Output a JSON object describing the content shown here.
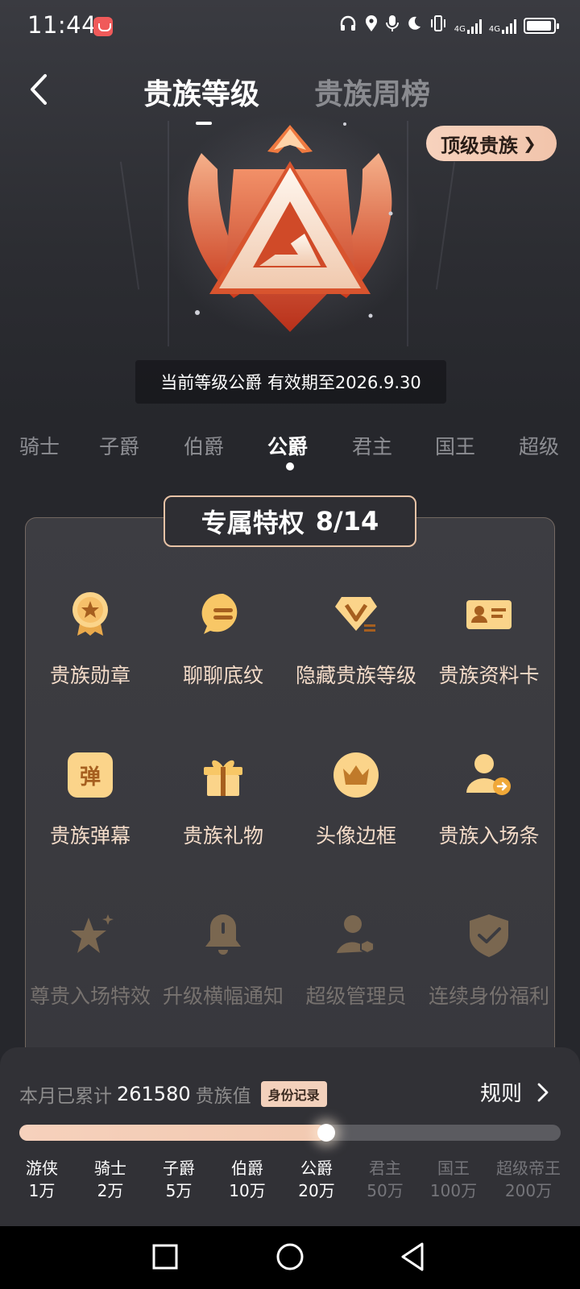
{
  "status_bar": {
    "time": "11:44",
    "network_tag_1": "4G",
    "network_tag_2": "4G"
  },
  "header": {
    "tab_active": "贵族等级",
    "tab_inactive": "贵族周榜",
    "top_noble_label": "顶级贵族"
  },
  "badge": {
    "name": "公爵徽章",
    "color_primary": "#e3562e",
    "color_light": "#f6dccb"
  },
  "validity": {
    "text": "当前等级公爵 有效期至2026.9.30"
  },
  "levels": [
    "骑士",
    "子爵",
    "伯爵",
    "公爵",
    "君主",
    "国王",
    "超级"
  ],
  "active_level": "公爵",
  "privileges": {
    "title": "专属特权",
    "count": "8/14",
    "items": [
      {
        "label": "贵族勋章",
        "icon": "medal-icon",
        "unlocked": true
      },
      {
        "label": "聊聊底纹",
        "icon": "chat-bubble-icon",
        "unlocked": true
      },
      {
        "label": "隐藏贵族等级",
        "icon": "diamond-v-icon",
        "unlocked": true
      },
      {
        "label": "贵族资料卡",
        "icon": "id-card-icon",
        "unlocked": true
      },
      {
        "label": "贵族弹幕",
        "icon": "danmaku-icon",
        "icon_text": "弹",
        "unlocked": true
      },
      {
        "label": "贵族礼物",
        "icon": "gift-icon",
        "unlocked": true
      },
      {
        "label": "头像边框",
        "icon": "crown-frame-icon",
        "unlocked": true
      },
      {
        "label": "贵族入场条",
        "icon": "user-enter-icon",
        "unlocked": true
      },
      {
        "label": "尊贵入场特效",
        "icon": "star-sparkle-icon",
        "unlocked": false
      },
      {
        "label": "升级横幅通知",
        "icon": "bell-icon",
        "unlocked": false
      },
      {
        "label": "超级管理员",
        "icon": "admin-user-icon",
        "unlocked": false
      },
      {
        "label": "连续身份福利",
        "icon": "shield-check-icon",
        "unlocked": false
      }
    ]
  },
  "progress": {
    "accum_prefix": "本月已累计",
    "accum_value": "261580",
    "accum_unit": "贵族值",
    "record_label": "身份记录",
    "rules_label": "规则",
    "fraction": 0.567
  },
  "tiers": [
    {
      "name": "游侠",
      "value": "1万",
      "reached": true
    },
    {
      "name": "骑士",
      "value": "2万",
      "reached": true
    },
    {
      "name": "子爵",
      "value": "5万",
      "reached": true
    },
    {
      "name": "伯爵",
      "value": "10万",
      "reached": true
    },
    {
      "name": "公爵",
      "value": "20万",
      "reached": true
    },
    {
      "name": "君主",
      "value": "50万",
      "reached": false
    },
    {
      "name": "国王",
      "value": "100万",
      "reached": false
    },
    {
      "name": "超级帝王",
      "value": "200万",
      "reached": false
    }
  ]
}
